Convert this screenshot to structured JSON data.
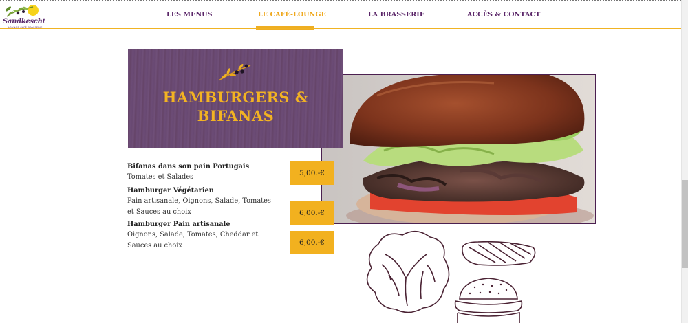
{
  "brand": {
    "name": "Sandkescht",
    "tagline": "LOUNGE·CAFÉ·BRASSERIE"
  },
  "nav": {
    "items": [
      {
        "label": "LES MENUS",
        "active": false
      },
      {
        "label": "LE CAFÉ-LOUNGE",
        "active": true
      },
      {
        "label": "LA BRASSERIE",
        "active": false
      },
      {
        "label": "ACCÈS & CONTACT",
        "active": false
      }
    ]
  },
  "section": {
    "title_line1": "HAMBURGERS &",
    "title_line2": "BIFANAS"
  },
  "menu": {
    "dishes": [
      {
        "name": "Bifanas dans son pain Portugais",
        "description": "Tomates et Salades",
        "price": "5,00.-€"
      },
      {
        "name": "Hamburger Végétarien",
        "description": "Pain artisanale, Oignons, Salade, Tomates et Sauces au choix",
        "price": "6,00.-€"
      },
      {
        "name": "Hamburger Pain artisanale",
        "description": "Oignons, Salade, Tomates, Cheddar et Sauces au choix",
        "price": "6,00.-€"
      }
    ]
  },
  "colors": {
    "accent": "#f2b11f",
    "brand_purple": "#5a2568",
    "panel": "#6a4a71"
  },
  "icons": {
    "logo": "olive-branch-sun-icon",
    "ornament": "olive-branch-icon",
    "photo": "hamburger-photo",
    "illustration": "burger-ingredients-sketch"
  }
}
